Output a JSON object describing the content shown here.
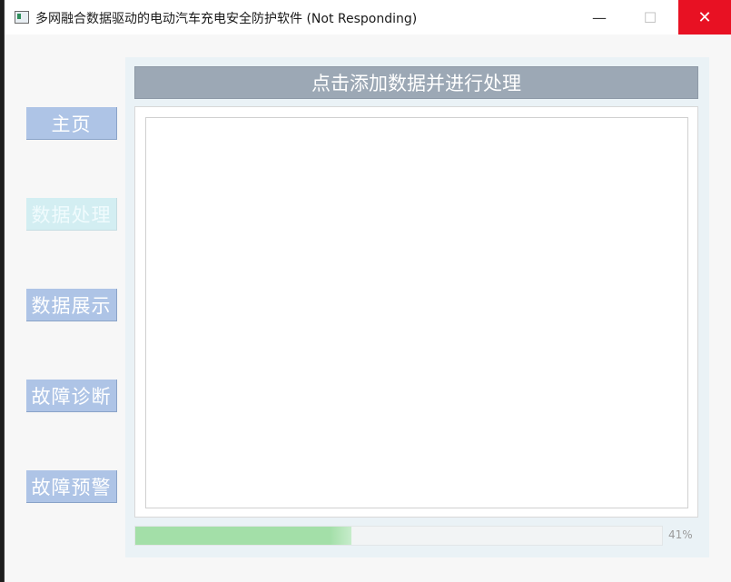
{
  "window": {
    "title": "多网融合数据驱动的电动汽车充电安全防护软件 (Not Responding)",
    "minimize_glyph": "—",
    "maximize_glyph": "☐",
    "close_glyph": "✕"
  },
  "nav": {
    "items": [
      {
        "label": "主页",
        "active": false
      },
      {
        "label": "数据处理",
        "active": true
      },
      {
        "label": "数据展示",
        "active": false
      },
      {
        "label": "故障诊断",
        "active": false
      },
      {
        "label": "故障预警",
        "active": false
      }
    ]
  },
  "main": {
    "header": "点击添加数据并进行处理",
    "progress": {
      "value": 41,
      "text": "41%"
    }
  },
  "colors": {
    "nav_button": "#aec4e6",
    "nav_active": "#d3eef2",
    "header_bar": "#9ca8b5",
    "progress_fill": "#a3dfa8",
    "close_button": "#e81123"
  },
  "icons": [
    "app-icon",
    "minimize-icon",
    "maximize-icon",
    "close-icon"
  ]
}
